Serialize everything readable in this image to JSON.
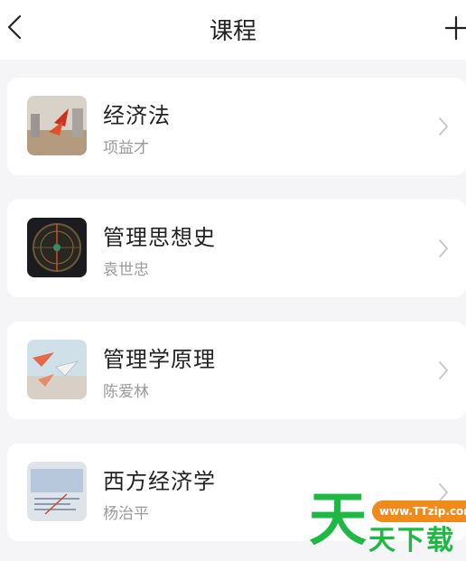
{
  "header": {
    "title": "课程",
    "back_icon": "chevron-left-icon",
    "add_icon": "plus-icon"
  },
  "courses": [
    {
      "name": "经济法",
      "teacher": "项益才"
    },
    {
      "name": "管理思想史",
      "teacher": "袁世忠"
    },
    {
      "name": "管理学原理",
      "teacher": "陈爱林"
    },
    {
      "name": "西方经济学",
      "teacher": "杨治平"
    }
  ],
  "watermark": {
    "big": "天",
    "url": "www.TTzip.com",
    "small": "天下载"
  },
  "colors": {
    "accent_green": "#1fb845",
    "accent_orange": "#f08a1a"
  }
}
